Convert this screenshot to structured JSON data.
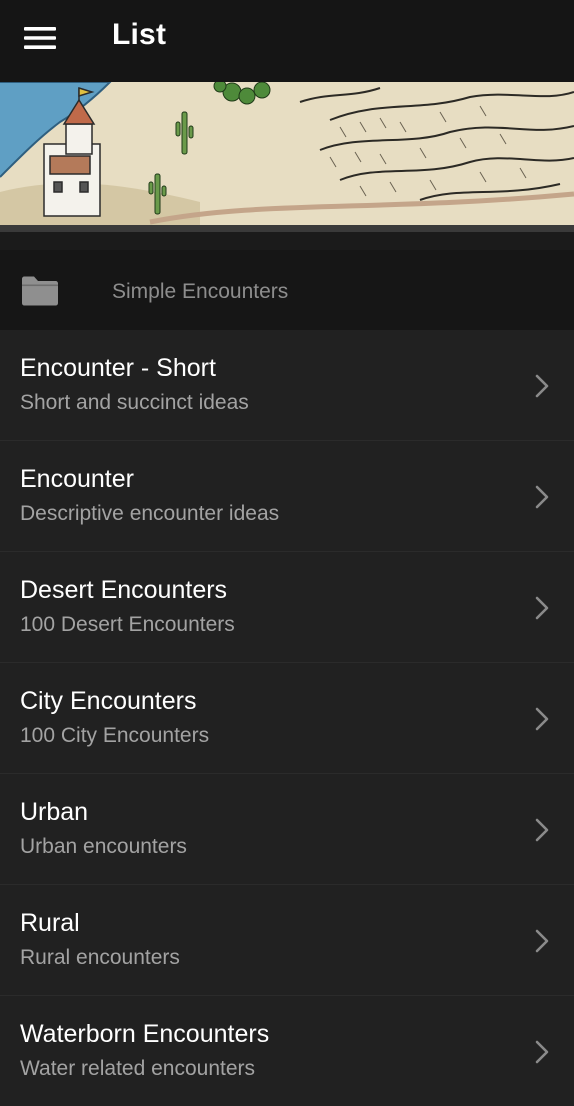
{
  "toolbar": {
    "title": "List",
    "menu_icon": "hamburger-menu-icon"
  },
  "banner": {
    "description_icon": "fantasy-map-banner"
  },
  "category": {
    "icon": "folder-icon",
    "label": "Simple Encounters"
  },
  "items": [
    {
      "title": "Encounter - Short",
      "subtitle": "Short and succinct ideas"
    },
    {
      "title": "Encounter",
      "subtitle": "Descriptive encounter ideas"
    },
    {
      "title": "Desert Encounters",
      "subtitle": "100 Desert Encounters"
    },
    {
      "title": "City Encounters",
      "subtitle": "100 City Encounters"
    },
    {
      "title": "Urban",
      "subtitle": "Urban encounters"
    },
    {
      "title": "Rural",
      "subtitle": "Rural encounters"
    },
    {
      "title": "Waterborn Encounters",
      "subtitle": "Water related encounters"
    }
  ],
  "colors": {
    "toolbar_bg": "#151515",
    "list_bg": "#212121",
    "title_text": "#ffffff",
    "subtitle_text": "#a3a3a3",
    "chevron": "#8a8a8a"
  }
}
